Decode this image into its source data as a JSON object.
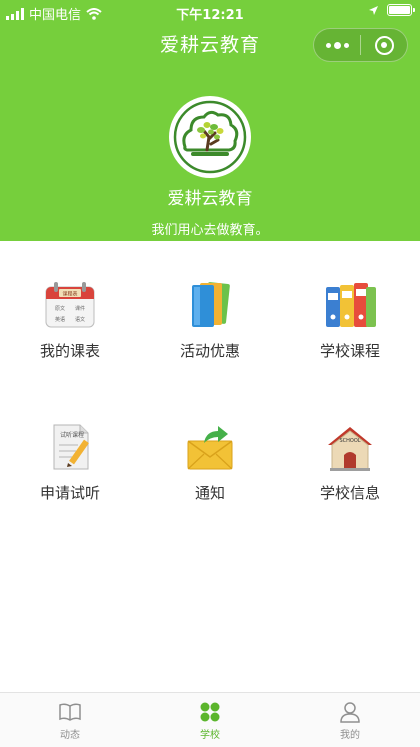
{
  "status_bar": {
    "carrier": "中国电信",
    "time": "下午12:21"
  },
  "nav": {
    "title": "爱耕云教育"
  },
  "profile": {
    "name": "爱耕云教育",
    "slogan": "我们用心去做教育。"
  },
  "logo_text": {
    "calendar_head": "课程表",
    "calendar_1": "原文",
    "calendar_2": "课件",
    "calendar_3": "英语",
    "calendar_4": "语文",
    "trial": "试听课程",
    "school": "SCHOOL"
  },
  "menu": [
    {
      "label": "我的课表",
      "icon": "calendar-icon"
    },
    {
      "label": "活动优惠",
      "icon": "cards-icon"
    },
    {
      "label": "学校课程",
      "icon": "binders-icon"
    },
    {
      "label": "申请试听",
      "icon": "trial-form-icon"
    },
    {
      "label": "通知",
      "icon": "mail-icon"
    },
    {
      "label": "学校信息",
      "icon": "school-house-icon"
    }
  ],
  "tabs": [
    {
      "label": "动态",
      "icon": "book-icon",
      "active": false
    },
    {
      "label": "学校",
      "icon": "school-grid-icon",
      "active": true
    },
    {
      "label": "我的",
      "icon": "person-icon",
      "active": false
    }
  ],
  "colors": {
    "brand": "#76cf3c",
    "tab_active": "#5bb52c",
    "tab_inactive": "#8f8f8f"
  }
}
